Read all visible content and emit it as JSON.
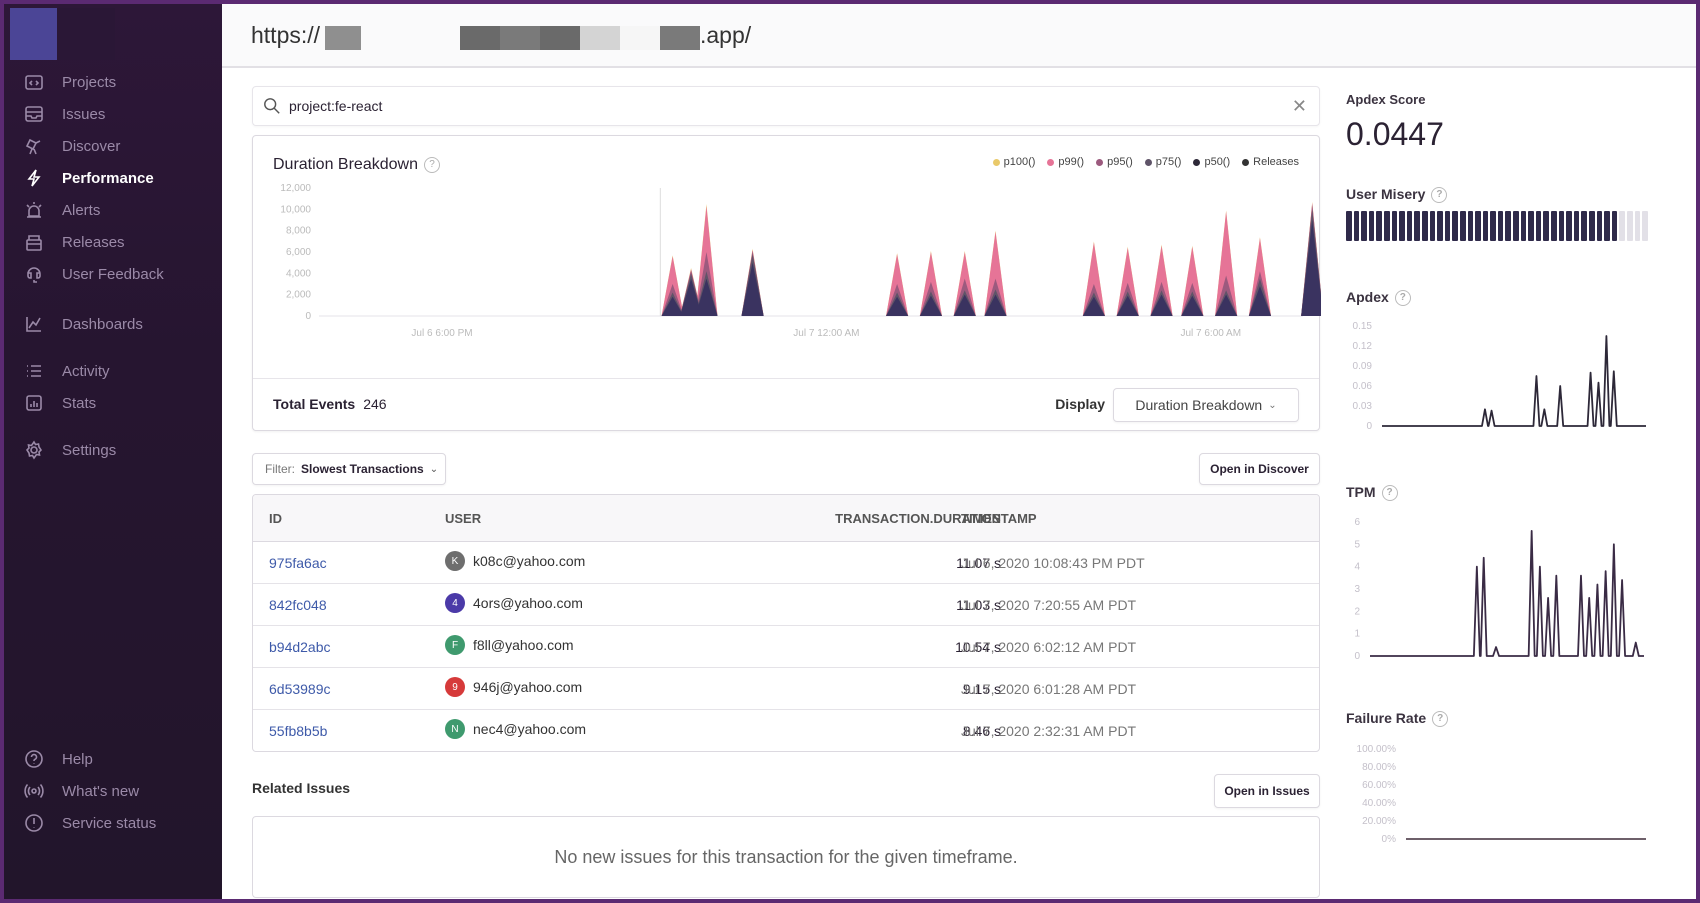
{
  "url": {
    "prefix": "https://",
    "suffix": ".app/"
  },
  "sidebar": {
    "items": [
      {
        "label": "Projects",
        "icon": "projects-icon",
        "active": false
      },
      {
        "label": "Issues",
        "icon": "issues-icon",
        "active": false
      },
      {
        "label": "Discover",
        "icon": "discover-icon",
        "active": false
      },
      {
        "label": "Performance",
        "icon": "performance-icon",
        "active": true
      },
      {
        "label": "Alerts",
        "icon": "alerts-icon",
        "active": false
      },
      {
        "label": "Releases",
        "icon": "releases-icon",
        "active": false
      },
      {
        "label": "User Feedback",
        "icon": "user-feedback-icon",
        "active": false
      },
      {
        "label": "Dashboards",
        "icon": "dashboards-icon",
        "active": false
      },
      {
        "label": "Activity",
        "icon": "activity-icon",
        "active": false
      },
      {
        "label": "Stats",
        "icon": "stats-icon",
        "active": false
      },
      {
        "label": "Settings",
        "icon": "settings-icon",
        "active": false
      }
    ],
    "footer": [
      {
        "label": "Help",
        "icon": "help-icon"
      },
      {
        "label": "What's new",
        "icon": "broadcast-icon"
      },
      {
        "label": "Service status",
        "icon": "status-icon"
      }
    ]
  },
  "search": {
    "value": "project:fe-react"
  },
  "duration_chart": {
    "title": "Duration Breakdown",
    "legend": [
      {
        "label": "p100()",
        "color": "#e9c96a"
      },
      {
        "label": "p99()",
        "color": "#e67497"
      },
      {
        "label": "p95()",
        "color": "#9c5a7e"
      },
      {
        "label": "p75()",
        "color": "#5f5468"
      },
      {
        "label": "p50()",
        "color": "#2d2838"
      },
      {
        "label": "Releases",
        "color": "#333333"
      }
    ],
    "y_ticks": [
      "12,000",
      "10,000",
      "8,000",
      "6,000",
      "4,000",
      "2,000",
      "0"
    ],
    "x_ticks": [
      "Jul 6 6:00 PM",
      "Jul 7 12:00 AM",
      "Jul 7 6:00 AM"
    ],
    "total_events_label": "Total Events",
    "total_events_value": "246",
    "display_label": "Display",
    "display_value": "Duration Breakdown"
  },
  "chart_data": [
    {
      "type": "area",
      "title": "Duration Breakdown",
      "xlabel": "",
      "ylabel": "",
      "ylim": [
        0,
        12000
      ],
      "x_ticks": [
        "Jul 6 6:00 PM",
        "Jul 7 12:00 AM",
        "Jul 7 6:00 AM"
      ],
      "x_range_hours": [
        0,
        16
      ],
      "legend_position": "top-right",
      "series": [
        {
          "name": "p100()",
          "x_hours": [
            5.75,
            6.05,
            6.3,
            7.05,
            9.4,
            9.95,
            10.5,
            11.0,
            12.6,
            13.15,
            13.7,
            14.2,
            14.75,
            15.3,
            16.15
          ],
          "values": [
            5700,
            4500,
            10500,
            6300,
            5900,
            6100,
            6100,
            8000,
            7000,
            6500,
            6700,
            6600,
            9900,
            7400,
            10700
          ]
        },
        {
          "name": "p99()",
          "x_hours": [
            5.75,
            6.05,
            6.3,
            7.05,
            9.4,
            9.95,
            10.5,
            11.0,
            12.6,
            13.15,
            13.7,
            14.2,
            14.75,
            15.3,
            16.15
          ],
          "values": [
            5600,
            4400,
            10300,
            6200,
            5800,
            6000,
            6000,
            7900,
            6900,
            6400,
            6600,
            6500,
            9800,
            7300,
            10600
          ]
        },
        {
          "name": "p95()",
          "x_hours": [
            5.75,
            6.05,
            6.3,
            7.05,
            9.4,
            9.95,
            10.5,
            11.0,
            12.6,
            13.15,
            13.7,
            14.2,
            14.75,
            15.3,
            16.15
          ],
          "values": [
            3000,
            4300,
            6000,
            6100,
            3000,
            3200,
            3500,
            3500,
            3000,
            3100,
            3200,
            3100,
            3800,
            4200,
            10500
          ]
        },
        {
          "name": "p75()",
          "x_hours": [
            5.75,
            6.05,
            6.3,
            7.05,
            9.4,
            9.95,
            10.5,
            11.0,
            12.6,
            13.15,
            13.7,
            14.2,
            14.75,
            15.3,
            16.15
          ],
          "values": [
            2200,
            4000,
            4200,
            5800,
            2200,
            2300,
            2400,
            2500,
            2200,
            2300,
            2400,
            2300,
            2400,
            3500,
            10000
          ]
        },
        {
          "name": "p50()",
          "x_hours": [
            5.75,
            6.05,
            6.3,
            7.05,
            9.4,
            9.95,
            10.5,
            11.0,
            12.6,
            13.15,
            13.7,
            14.2,
            14.75,
            15.3,
            16.15
          ],
          "values": [
            1800,
            3500,
            3500,
            5000,
            1800,
            1900,
            2000,
            2000,
            1800,
            1900,
            2000,
            1900,
            2000,
            2800,
            9000
          ]
        }
      ]
    },
    {
      "type": "line",
      "title": "Apdex",
      "ylim": [
        0,
        0.15
      ],
      "y_ticks": [
        "0.15",
        "0.12",
        "0.09",
        "0.06",
        "0.03",
        "0"
      ],
      "x_frac": [
        0.39,
        0.415,
        0.585,
        0.615,
        0.675,
        0.79,
        0.82,
        0.85,
        0.878
      ],
      "values": [
        0.025,
        0.023,
        0.075,
        0.025,
        0.06,
        0.08,
        0.065,
        0.135,
        0.082
      ]
    },
    {
      "type": "line",
      "title": "TPM",
      "ylim": [
        0,
        6
      ],
      "y_ticks": [
        "6",
        "5",
        "4",
        "3",
        "2",
        "1",
        "0"
      ],
      "x_frac": [
        0.39,
        0.415,
        0.46,
        0.59,
        0.62,
        0.65,
        0.68,
        0.77,
        0.8,
        0.83,
        0.86,
        0.89,
        0.92,
        0.97
      ],
      "values": [
        4.0,
        4.4,
        0.4,
        5.6,
        4.0,
        2.6,
        3.6,
        3.6,
        2.6,
        3.2,
        3.8,
        5.0,
        3.4,
        0.6
      ]
    },
    {
      "type": "line",
      "title": "Failure Rate",
      "ylim": [
        0,
        100
      ],
      "y_ticks": [
        "100.00%",
        "80.00%",
        "60.00%",
        "40.00%",
        "20.00%",
        "0%"
      ],
      "x_frac": [
        0,
        1
      ],
      "values": [
        0,
        0
      ]
    }
  ],
  "filter": {
    "prefix": "Filter:",
    "value": "Slowest Transactions"
  },
  "open_discover_label": "Open in Discover",
  "table": {
    "columns": [
      "ID",
      "USER",
      "TRANSACTION.DURATION",
      "TIMESTAMP"
    ],
    "rows": [
      {
        "id": "975fa6ac",
        "initial": "K",
        "avatar_color": "#6e6e6e",
        "user": "k08c@yahoo.com",
        "duration": "11.07 s",
        "timestamp": "Jul 6, 2020 10:08:43 PM PDT"
      },
      {
        "id": "842fc048",
        "initial": "4",
        "avatar_color": "#4b3aa8",
        "user": "4ors@yahoo.com",
        "duration": "11.03 s",
        "timestamp": "Jul 7, 2020 7:20:55 AM PDT"
      },
      {
        "id": "b94d2abc",
        "initial": "F",
        "avatar_color": "#3f9a6e",
        "user": "f8ll@yahoo.com",
        "duration": "10.54 s",
        "timestamp": "Jul 7, 2020 6:02:12 AM PDT"
      },
      {
        "id": "6d53989c",
        "initial": "9",
        "avatar_color": "#d63a3a",
        "user": "946j@yahoo.com",
        "duration": "9.15 s",
        "timestamp": "Jul 7, 2020 6:01:28 AM PDT"
      },
      {
        "id": "55fb8b5b",
        "initial": "N",
        "avatar_color": "#3f9a6e",
        "user": "nec4@yahoo.com",
        "duration": "8.46 s",
        "timestamp": "Jul 7, 2020 2:32:31 AM PDT"
      }
    ]
  },
  "related_issues": {
    "label": "Related Issues",
    "open_label": "Open in Issues",
    "empty_text": "No new issues for this transaction for the given timeframe."
  },
  "sidebar_right": {
    "apdex_score_label": "Apdex Score",
    "apdex_score_value": "0.0447",
    "user_misery_label": "User Misery",
    "user_misery_fraction": 0.9,
    "user_misery_bars_total": 40,
    "apdex_label": "Apdex",
    "tpm_label": "TPM",
    "failure_rate_label": "Failure Rate"
  },
  "colors": {
    "sidebar_bg": "#261530",
    "frame": "#5b2a72",
    "link": "#3e5aa9",
    "line": "#2d2838",
    "tpm_line": "#3a2b45"
  }
}
